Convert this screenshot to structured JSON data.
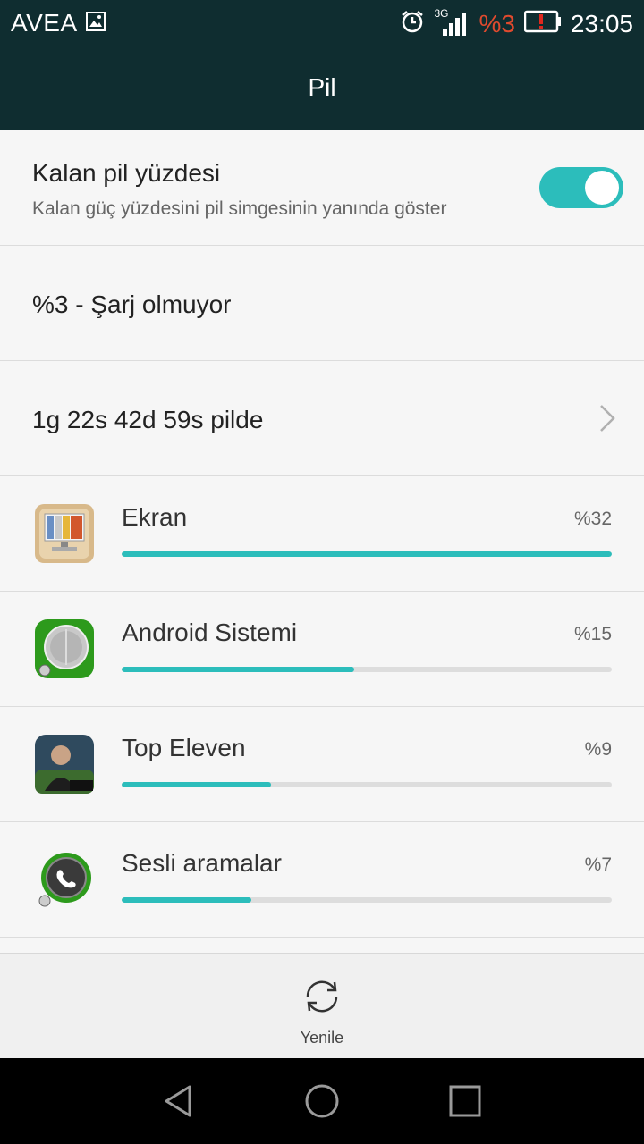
{
  "status_bar": {
    "carrier": "AVEA",
    "network": "3G",
    "battery_percent": "%3",
    "time": "23:05",
    "icons": [
      "image-icon",
      "alarm-icon",
      "signal-icon",
      "battery-low-icon"
    ]
  },
  "header": {
    "title": "Pil"
  },
  "settings": {
    "battery_percent_toggle": {
      "title": "Kalan pil yüzdesi",
      "subtitle": "Kalan güç yüzdesini pil simgesinin yanında göster",
      "enabled": true
    },
    "charge_status": "%3 - Şarj olmuyor",
    "time_on_battery": "1g 22s 42d 59s pilde"
  },
  "usage": [
    {
      "name": "Ekran",
      "percent": "%32",
      "fill": 1.0,
      "icon": "screen-icon"
    },
    {
      "name": "Android Sistemi",
      "percent": "%15",
      "fill": 0.475,
      "icon": "android-system-icon"
    },
    {
      "name": "Top Eleven",
      "percent": "%9",
      "fill": 0.305,
      "icon": "top-eleven-icon"
    },
    {
      "name": "Sesli aramalar",
      "percent": "%7",
      "fill": 0.265,
      "icon": "phone-call-icon"
    }
  ],
  "actions": {
    "refresh_label": "Yenile"
  },
  "colors": {
    "accent": "#2cbdbb",
    "header_bg": "#0f2d30",
    "warning": "#e04a2e"
  }
}
